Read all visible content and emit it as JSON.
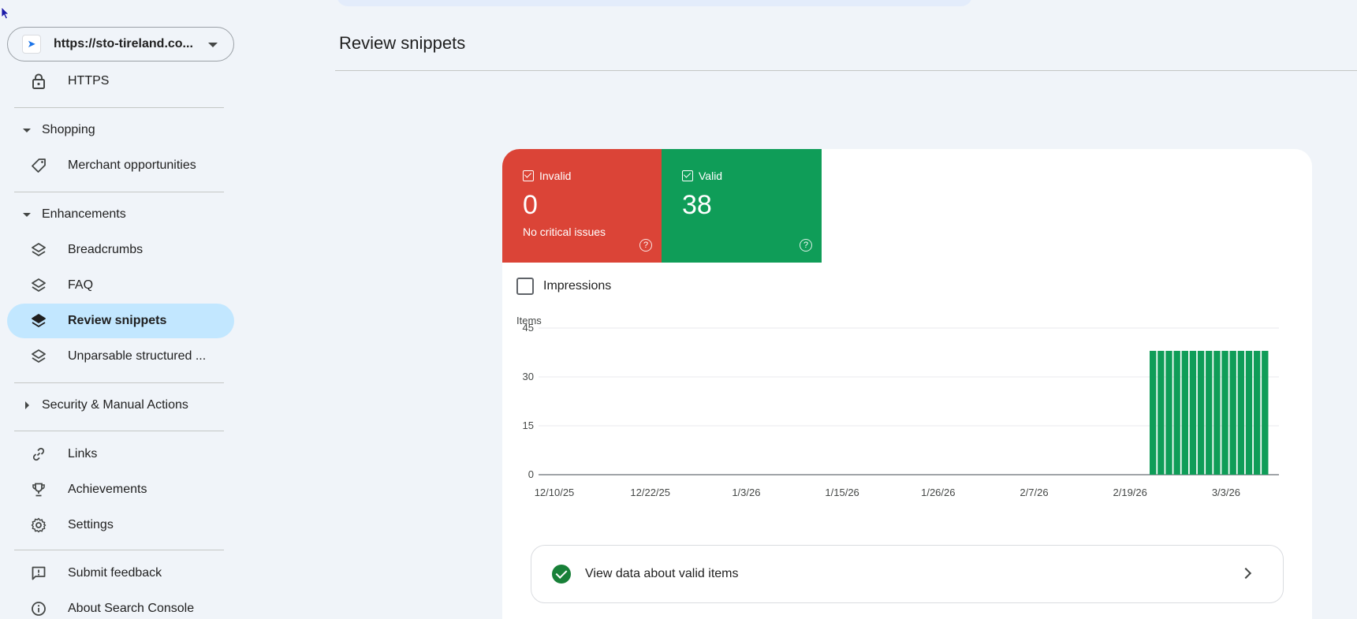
{
  "sidebar": {
    "property_url": "https://sto-tireland.co...",
    "https_label": "HTTPS",
    "shopping": {
      "label": "Shopping",
      "items": [
        "Merchant opportunities"
      ]
    },
    "enhancements": {
      "label": "Enhancements",
      "items": [
        "Breadcrumbs",
        "FAQ",
        "Review snippets",
        "Unparsable structured ..."
      ]
    },
    "security": {
      "label": "Security & Manual Actions"
    },
    "links": "Links",
    "achievements": "Achievements",
    "settings": "Settings",
    "submit_feedback": "Submit feedback",
    "about": "About Search Console"
  },
  "main": {
    "title": "Review snippets",
    "invalid": {
      "label": "Invalid",
      "value": "0",
      "sub": "No critical issues",
      "color": "#db4437"
    },
    "valid": {
      "label": "Valid",
      "value": "38",
      "color": "#0f9d58"
    },
    "impressions_label": "Impressions",
    "view_valid_label": "View data about valid items"
  },
  "chart_data": {
    "type": "bar",
    "ylabel": "Items",
    "ylim": [
      0,
      45
    ],
    "yticks": [
      0,
      15,
      30,
      45
    ],
    "xtick_labels": [
      "12/10/25",
      "12/22/25",
      "1/3/26",
      "1/15/26",
      "1/26/26",
      "2/7/26",
      "2/19/26",
      "3/3/26"
    ],
    "series": [
      {
        "color": "#0f9d58",
        "values": [
          38,
          38,
          38,
          38,
          38,
          38,
          38,
          38,
          38,
          38,
          38,
          38,
          38,
          38,
          38
        ]
      }
    ],
    "bar_start_date": "2/22/26",
    "grid": true,
    "legend": "none"
  }
}
